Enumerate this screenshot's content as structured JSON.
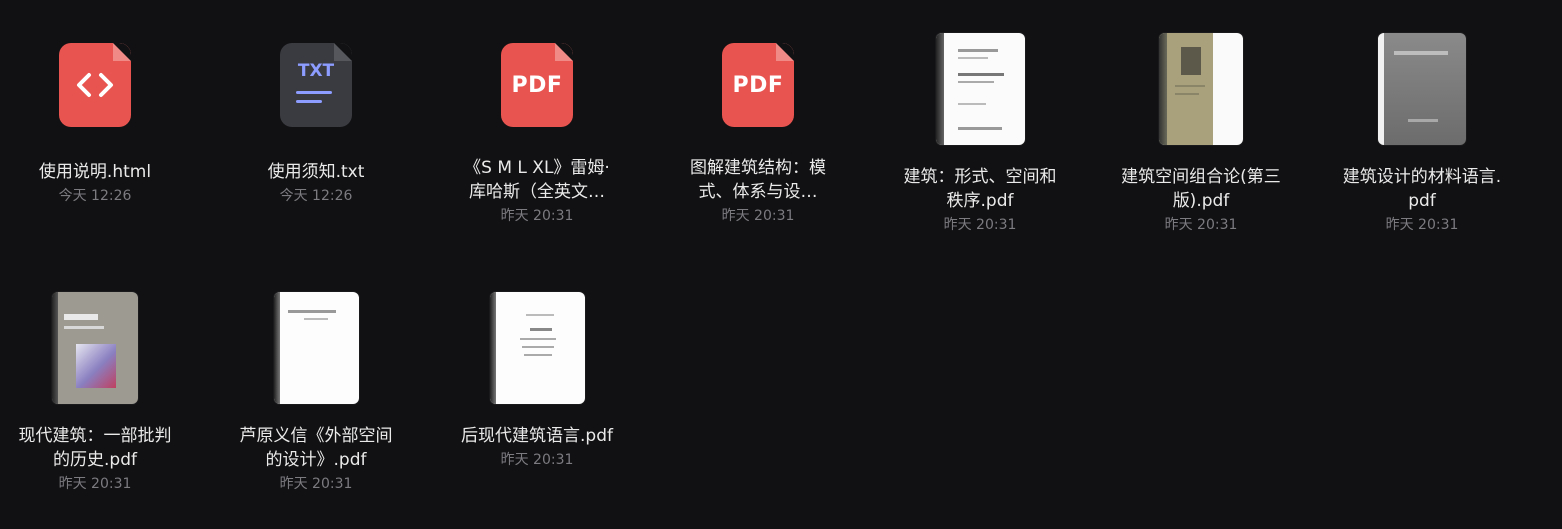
{
  "files": [
    {
      "name": "使用说明.html",
      "time": "今天 12:26",
      "icon": "code-file-icon"
    },
    {
      "name": "使用须知.txt",
      "time": "今天 12:26",
      "icon": "txt-file-icon",
      "icon_text": "TXT"
    },
    {
      "name": "《S M L XL》雷姆·库哈斯（全英文…",
      "time": "昨天 20:31",
      "icon": "pdf-file-icon",
      "icon_text": "PDF"
    },
    {
      "name": "图解建筑结构：模式、体系与设…",
      "time": "昨天 20:31",
      "icon": "pdf-file-icon",
      "icon_text": "PDF"
    },
    {
      "name": "建筑：形式、空间和秩序.pdf",
      "time": "昨天 20:31",
      "icon": "book-cover-thumbnail"
    },
    {
      "name": "建筑空间组合论(第三版).pdf",
      "time": "昨天 20:31",
      "icon": "book-cover-thumbnail"
    },
    {
      "name": "建筑设计的材料语言.pdf",
      "time": "昨天 20:31",
      "icon": "book-cover-thumbnail"
    },
    {
      "name": "现代建筑：一部批判的历史.pdf",
      "time": "昨天 20:31",
      "icon": "book-cover-thumbnail"
    },
    {
      "name": "芦原义信《外部空间的设计》.pdf",
      "time": "昨天 20:31",
      "icon": "book-cover-thumbnail"
    },
    {
      "name": "后现代建筑语言.pdf",
      "time": "昨天 20:31",
      "icon": "book-cover-thumbnail"
    }
  ],
  "colors": {
    "background": "#111113",
    "pdf_red": "#e85450",
    "txt_accent": "#8c9cff"
  }
}
